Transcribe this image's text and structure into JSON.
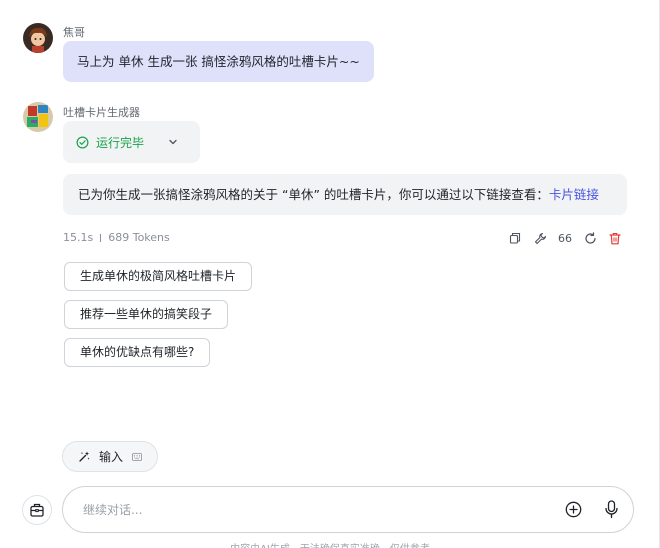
{
  "user_message": {
    "sender_name": "焦哥",
    "text": "马上为 单休 生成一张 搞怪涂鸦风格的吐槽卡片~~"
  },
  "bot_message": {
    "sender_name": "吐槽卡片生成器",
    "status_label": "运行完毕",
    "answer_text": "已为你生成一张搞怪涂鸦风格的关于 “单休” 的吐槽卡片，你可以通过以下链接查看：",
    "answer_link": "卡片链接",
    "time": "15.1s",
    "tokens": "689 Tokens",
    "quote_glyph": "66"
  },
  "suggestions": [
    "生成单休的极简风格吐槽卡片",
    "推荐一些单休的搞笑段子",
    "单休的优缺点有哪些?"
  ],
  "input_chip_label": "输入",
  "composer": {
    "placeholder": "继续对话..."
  },
  "footer_text": "内容由AI生成，无法确保真实准确，仅供参考",
  "colors": {
    "user_bubble": "#dfe1fb",
    "status_green": "#1aa34a",
    "link": "#4a55e0",
    "delete_red": "#e53935"
  },
  "icons": {
    "status": "check-circle-icon",
    "status_toggle": "chevron-down-icon",
    "copy": "copy-icon",
    "tool": "wrench-icon",
    "quote": "quote-icon",
    "regenerate": "refresh-icon",
    "delete": "trash-icon",
    "input_mode": "sparkle-icon",
    "keyboard": "keyboard-icon",
    "side": "briefcase-icon",
    "attach": "plus-circle-icon",
    "voice": "microphone-icon"
  }
}
